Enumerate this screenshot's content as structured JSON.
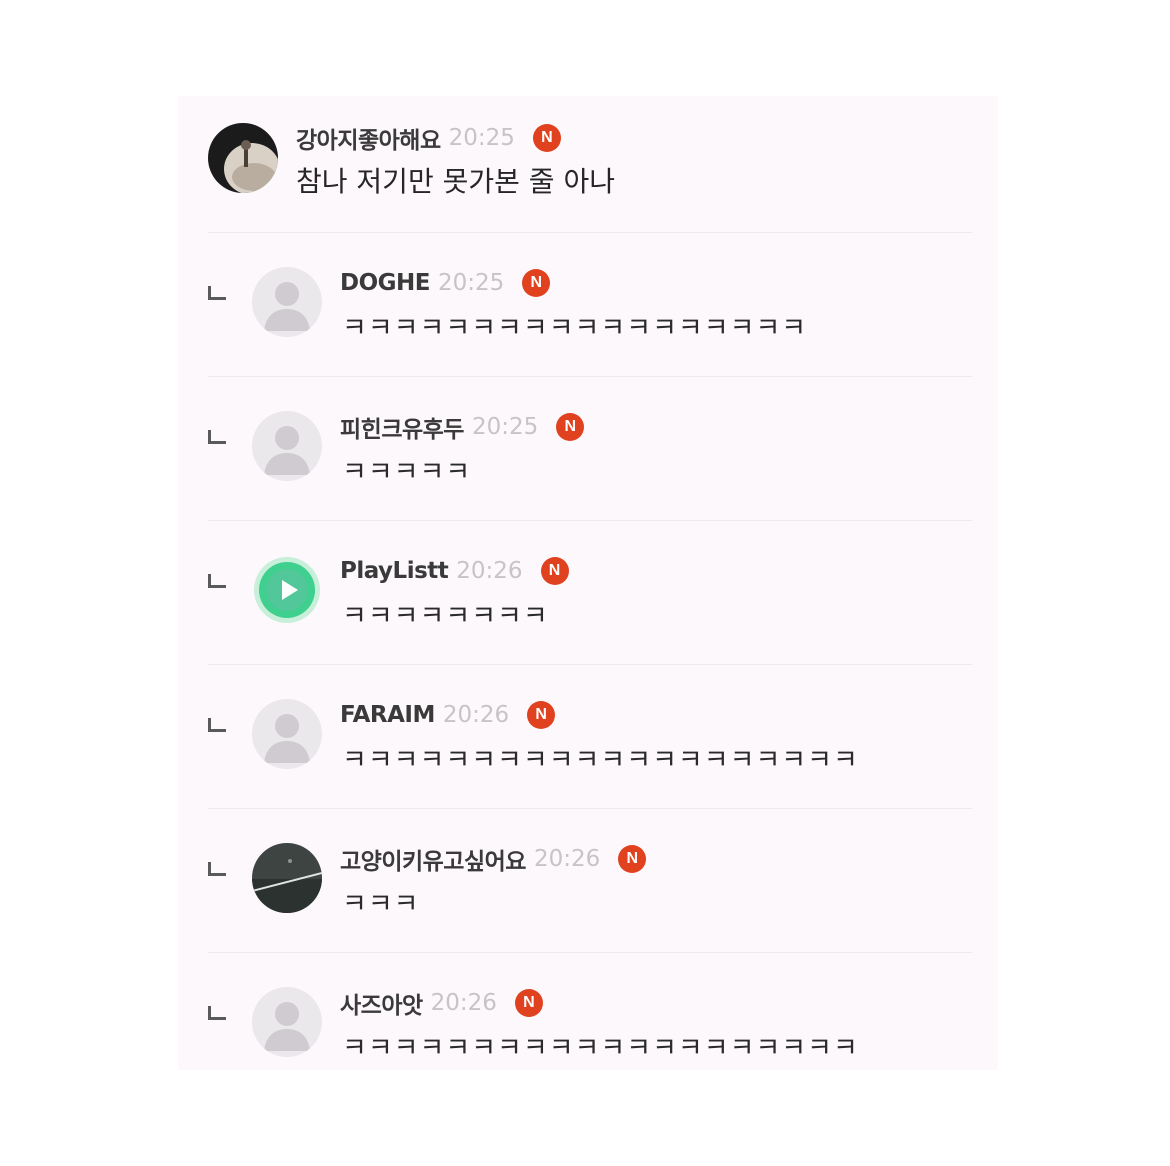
{
  "comments": [
    {
      "author": "강아지좋아해요",
      "time": "20:25",
      "badge": "N",
      "text": "참나 저기만 못가본 줄 아나",
      "avatar": "photo-avatar"
    },
    {
      "author": "DOGHE",
      "time": "20:25",
      "badge": "N",
      "text": "ㅋㅋㅋㅋㅋㅋㅋㅋㅋㅋㅋㅋㅋㅋㅋㅋㅋㅋ",
      "avatar": "default-user-avatar"
    },
    {
      "author": "피힌크유후두",
      "time": "20:25",
      "badge": "N",
      "text": "ㅋㅋㅋㅋㅋ",
      "avatar": "default-user-avatar"
    },
    {
      "author": "PlayListt",
      "time": "20:26",
      "badge": "N",
      "text": "ㅋㅋㅋㅋㅋㅋㅋㅋ",
      "avatar": "play-button-avatar"
    },
    {
      "author": "FARAIM",
      "time": "20:26",
      "badge": "N",
      "text": "ㅋㅋㅋㅋㅋㅋㅋㅋㅋㅋㅋㅋㅋㅋㅋㅋㅋㅋㅋㅋ",
      "avatar": "default-user-avatar"
    },
    {
      "author": "고양이키유고싶어요",
      "time": "20:26",
      "badge": "N",
      "text": "ㅋㅋㅋ",
      "avatar": "dark-photo-avatar"
    },
    {
      "author": "사즈아앗",
      "time": "20:26",
      "badge": "N",
      "text": "ㅋㅋㅋㅋㅋㅋㅋㅋㅋㅋㅋㅋㅋㅋㅋㅋㅋㅋㅋㅋ",
      "avatar": "default-user-avatar"
    }
  ],
  "colors": {
    "badge": "#e0411f",
    "time": "#c7c3c6",
    "author": "#3a3a3a",
    "play_accent": "#3fcf8e"
  }
}
